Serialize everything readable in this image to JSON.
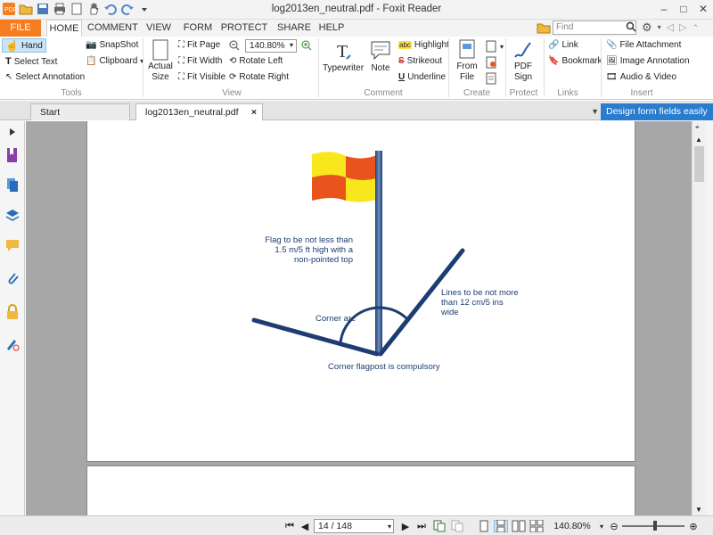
{
  "window": {
    "title": "log2013en_neutral.pdf - Foxit Reader"
  },
  "ribbon_tabs": [
    "FILE",
    "HOME",
    "COMMENT",
    "VIEW",
    "FORM",
    "PROTECT",
    "SHARE",
    "HELP"
  ],
  "search": {
    "placeholder": "Find"
  },
  "tools": {
    "hand": "Hand",
    "select_text": "Select Text",
    "select_annotation": "Select Annotation",
    "snapshot": "SnapShot",
    "clipboard": "Clipboard",
    "group": "Tools"
  },
  "view": {
    "actual_size_1": "Actual",
    "actual_size_2": "Size",
    "fit_page": "Fit Page",
    "fit_width": "Fit Width",
    "fit_visible": "Fit Visible",
    "zoom": "140.80%",
    "rotate_left": "Rotate Left",
    "rotate_right": "Rotate Right",
    "group": "View"
  },
  "comment": {
    "typewriter": "Typewriter",
    "note": "Note",
    "highlight": "Highlight",
    "strikeout": "Strikeout",
    "underline": "Underline",
    "group": "Comment"
  },
  "create": {
    "from_file_1": "From",
    "from_file_2": "File",
    "group": "Create"
  },
  "protect": {
    "pdf_sign_1": "PDF",
    "pdf_sign_2": "Sign",
    "group": "Protect"
  },
  "links": {
    "link": "Link",
    "bookmark": "Bookmark",
    "group": "Links"
  },
  "insert": {
    "file_attachment": "File Attachment",
    "image_annotation": "Image Annotation",
    "audio_video": "Audio & Video",
    "group": "Insert"
  },
  "doc_tabs": {
    "start": "Start",
    "file": "log2013en_neutral.pdf",
    "close": "×"
  },
  "promo": "Design form fields easily",
  "diagram": {
    "flag_label": [
      "Flag to be not less than",
      "1.5 m/5 ft high with a",
      "non-pointed top"
    ],
    "lines_label": [
      "Lines to be not more",
      "than 12 cm/5 ins",
      "wide"
    ],
    "corner_arc": "Corner arc",
    "compulsory": "Corner flagpost is compulsory",
    "colors": {
      "navy": "#1d3d72",
      "yellow": "#f8e71c",
      "orange": "#e8541c"
    }
  },
  "status": {
    "page": "14 / 148",
    "zoom": "140.80%"
  }
}
